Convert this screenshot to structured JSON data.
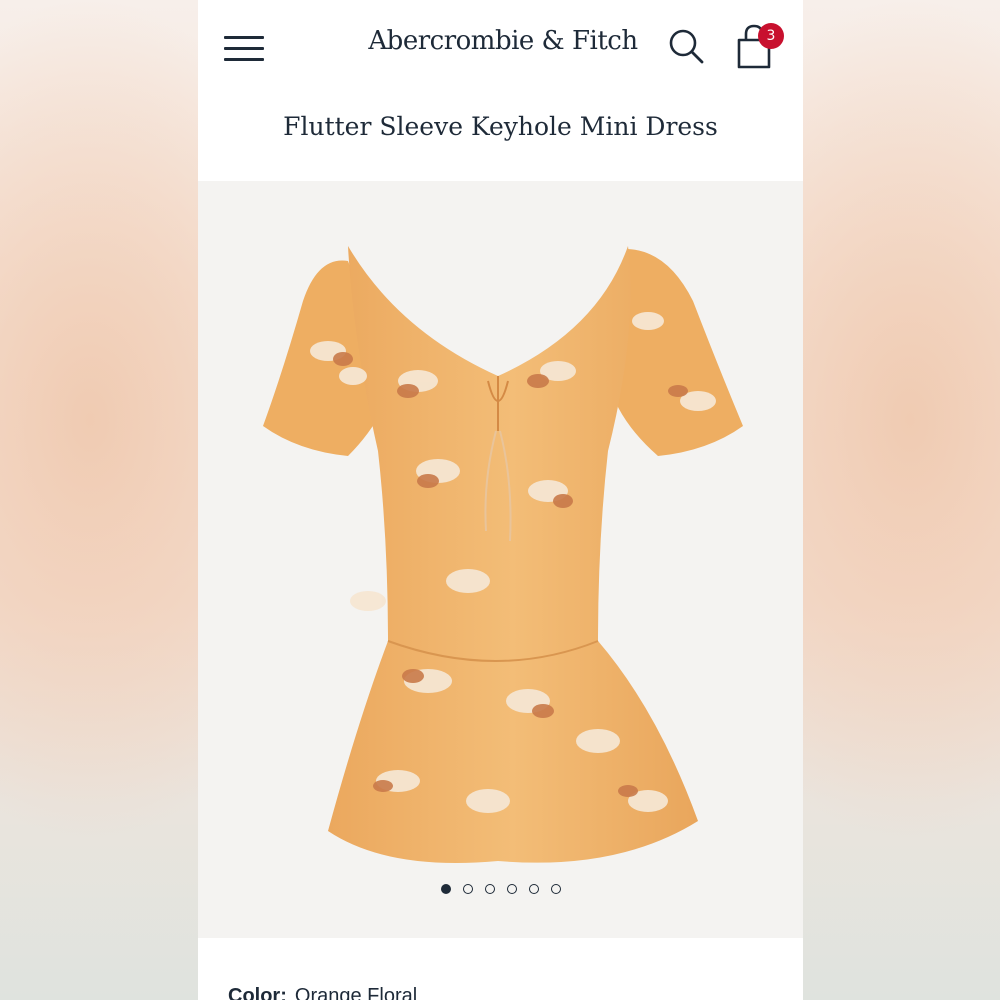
{
  "header": {
    "brand": "Abercrombie & Fitch",
    "menu_icon": "hamburger-menu-icon",
    "search_icon": "search-icon",
    "bag_icon": "shopping-bag-icon",
    "bag_count": "3",
    "badge_color": "#c8102e",
    "text_color": "#1e2a38"
  },
  "product": {
    "title": "Flutter Sleeve Keyhole Mini Dress",
    "image": {
      "description_icon": "product-image",
      "dress_color": "#f0b56a"
    },
    "carousel": {
      "total": 6,
      "active_index": 0
    },
    "color": {
      "label": "Color:",
      "value": "Orange Floral"
    }
  }
}
